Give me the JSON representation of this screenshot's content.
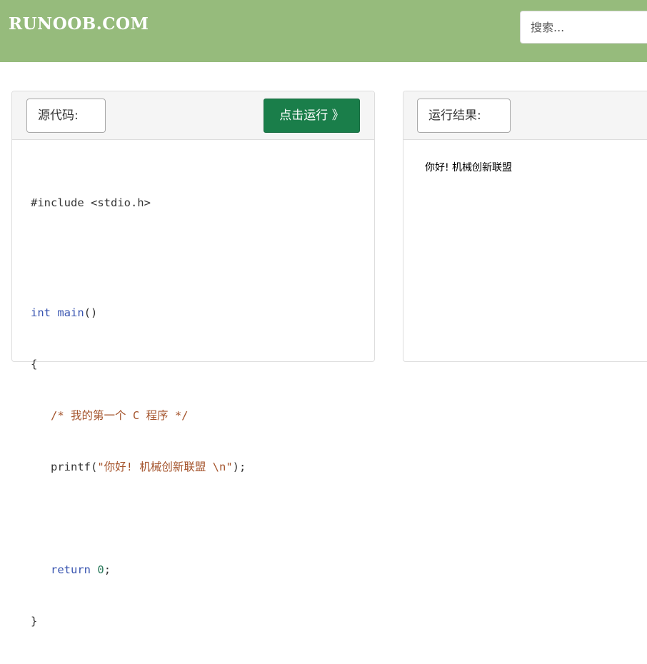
{
  "header": {
    "logo": "RUNOOB.COM",
    "search_placeholder": "搜索..."
  },
  "source_panel": {
    "label": "源代码:",
    "run_button": "点击运行 》",
    "code": {
      "include": "#include <stdio.h>",
      "int_kw": "int",
      "main_fn": "main",
      "main_rest": "()",
      "brace_open": "{",
      "comment": "/* 我的第一个 C 程序 */",
      "printf_fn": "printf(",
      "printf_str": "\"你好! 机械创新联盟 \\n\"",
      "printf_end": ");",
      "return_kw": "return",
      "return_val": "0",
      "return_end": ";",
      "brace_close": "}"
    }
  },
  "result_panel": {
    "label": "运行结果:",
    "output": "你好! 机械创新联盟"
  },
  "colors": {
    "navbar": "#96bb7c",
    "run_button": "#1a7e4a"
  }
}
